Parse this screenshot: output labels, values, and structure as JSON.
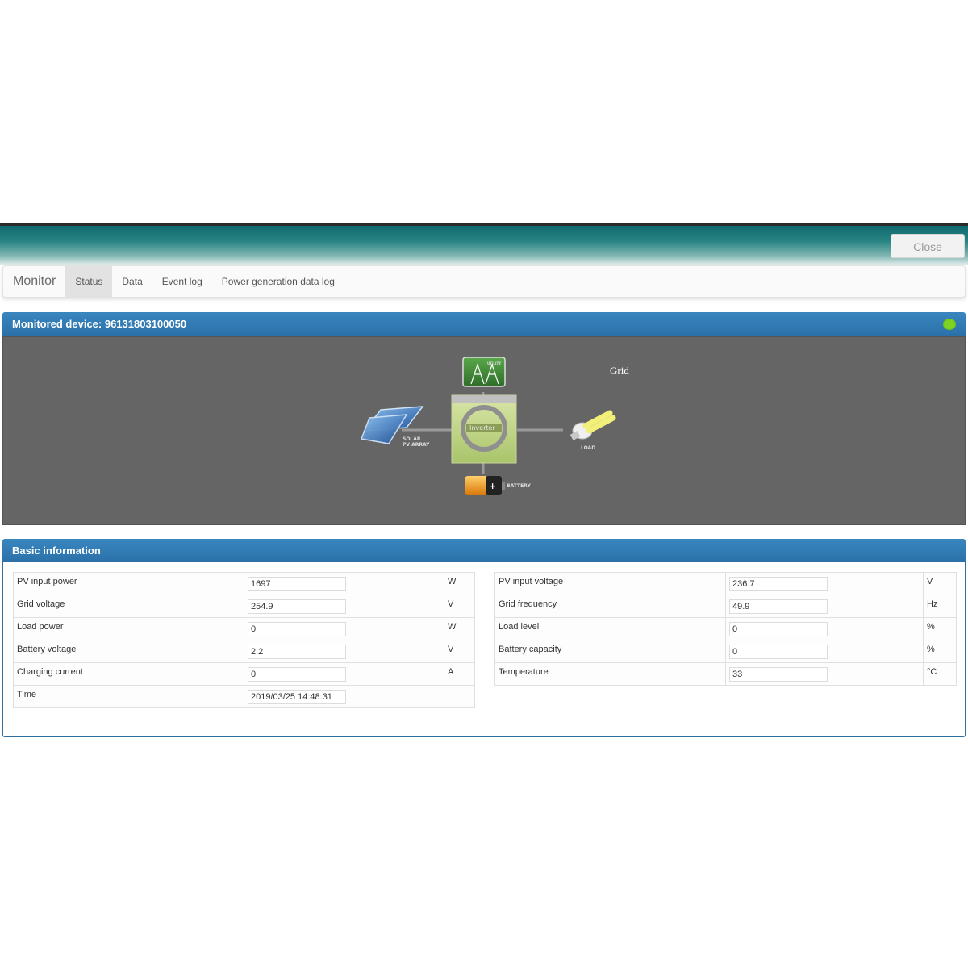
{
  "window": {
    "close_label": "Close"
  },
  "navbar": {
    "brand": "Monitor",
    "tabs": [
      {
        "label": "Status",
        "active": true
      },
      {
        "label": "Data"
      },
      {
        "label": "Event log"
      },
      {
        "label": "Power generation data log"
      }
    ]
  },
  "device_panel": {
    "title": "Monitored device: 96131803100050",
    "status_color": "#7ed321",
    "mode_label": "Grid",
    "diagram": {
      "utility_label": "UTILITY",
      "solar_label_1": "SOLAR",
      "solar_label_2": "PV ARRAY",
      "inverter_label": "Inverter",
      "load_label": "LOAD",
      "battery_label": "BATTERY"
    }
  },
  "basic_info": {
    "title": "Basic information",
    "left": [
      {
        "label": "PV input power",
        "value": "1697",
        "unit": "W"
      },
      {
        "label": "Grid voltage",
        "value": "254.9",
        "unit": "V"
      },
      {
        "label": "Load power",
        "value": "0",
        "unit": "W"
      },
      {
        "label": "Battery voltage",
        "value": "2.2",
        "unit": "V"
      },
      {
        "label": "Charging current",
        "value": "0",
        "unit": "A"
      },
      {
        "label": "Time",
        "value": "2019/03/25 14:48:31",
        "unit": ""
      }
    ],
    "right": [
      {
        "label": "PV input voltage",
        "value": "236.7",
        "unit": "V"
      },
      {
        "label": "Grid frequency",
        "value": "49.9",
        "unit": "Hz"
      },
      {
        "label": "Load level",
        "value": "0",
        "unit": "%"
      },
      {
        "label": "Battery capacity",
        "value": "0",
        "unit": "%"
      },
      {
        "label": "Temperature",
        "value": "33",
        "unit": "°C"
      }
    ]
  }
}
